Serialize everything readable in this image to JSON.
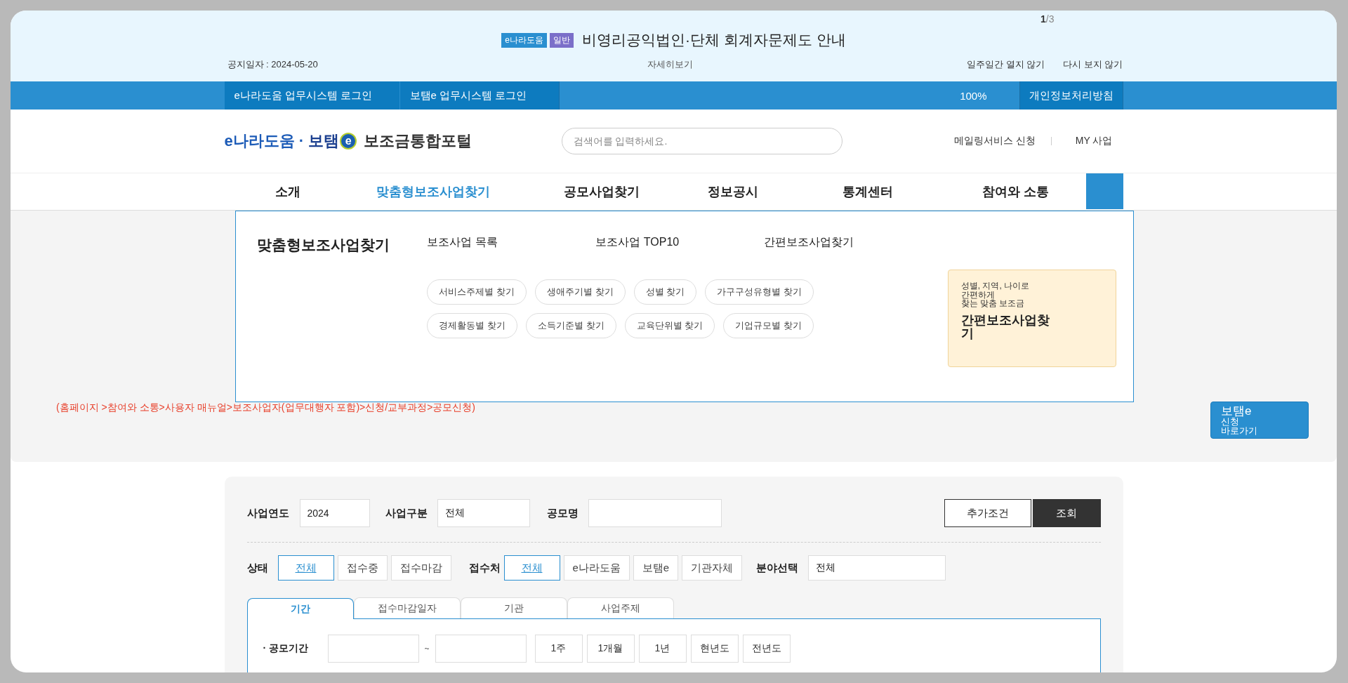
{
  "notice": {
    "counter": {
      "current": "1",
      "total": "/3"
    },
    "badges": [
      {
        "label": "e나라도움",
        "color": "#2a8fd0"
      },
      {
        "label": "일반",
        "color": "#7b6fc9"
      }
    ],
    "title": "비영리공익법인·단체 회계자문제도 안내",
    "date": "공지일자 : 2024-05-20",
    "detail": "자세히보기",
    "actions": [
      "일주일간 열지 않기",
      "다시 보지 않기"
    ]
  },
  "topbar": {
    "logins": [
      "e나라도움 업무시스템 로그인",
      "보탬e 업무시스템 로그인"
    ],
    "zoom": "100%",
    "privacy": "개인정보처리방침"
  },
  "header": {
    "logo": {
      "brand_1": "e나라도움",
      "dot": "·",
      "brand_2": "보탬",
      "mark": "e",
      "portal": "보조금통합포털"
    },
    "search": {
      "placeholder": "검색어를 입력하세요."
    },
    "links": [
      "메일링서비스 신청",
      "MY 사업"
    ]
  },
  "nav": {
    "items": [
      {
        "label": "소개",
        "selected": false
      },
      {
        "label": "맞춤형보조사업찾기",
        "selected": true
      },
      {
        "label": "공모사업찾기",
        "selected": false
      },
      {
        "label": "정보공시",
        "selected": false
      },
      {
        "label": "통계센터",
        "selected": false
      },
      {
        "label": "참여와 소통",
        "selected": false
      }
    ]
  },
  "megamenu": {
    "title": "맞춤형보조사업찾기",
    "links": [
      "보조사업 목록",
      "보조사업 TOP10",
      "간편보조사업찾기"
    ],
    "chips": [
      [
        "서비스주제별 찾기",
        "생애주기별 찾기",
        "성별 찾기",
        "가구구성유형별 찾기"
      ],
      [
        "경제활동별 찾기",
        "소득기준별 찾기",
        "교육단위별 찾기",
        "기업규모별 찾기"
      ]
    ],
    "promo": {
      "lines": [
        "성별, 지역, 나이로",
        "간편하게",
        "찾는 맞춤 보조금"
      ],
      "title": "간편보조사업찾기"
    }
  },
  "guide": {
    "breadcrumb": "(홈페이지 >참여와 소통>사용자 매뉴얼>보조사업자(업무대행자 포함)>신청/교부과정>공모신청)",
    "button": [
      "보탬e",
      "신청",
      "바로가기"
    ]
  },
  "search_form": {
    "fields": [
      {
        "label": "사업연도",
        "value": "2024"
      },
      {
        "label": "사업구분",
        "value": "전체"
      },
      {
        "label": "공모명"
      }
    ],
    "buttons": [
      {
        "label": "추가조건",
        "kind": "outline"
      },
      {
        "label": "조회",
        "kind": "dark"
      }
    ],
    "status": {
      "label": "상태",
      "options": [
        {
          "label": "전체",
          "selected": true
        },
        {
          "label": "접수중",
          "selected": false
        },
        {
          "label": "접수마감",
          "selected": false
        }
      ]
    },
    "receiver": {
      "label": "접수처",
      "options": [
        {
          "label": "전체",
          "selected": true
        },
        {
          "label": "e나라도움",
          "selected": false
        },
        {
          "label": "보탬e",
          "selected": false
        },
        {
          "label": "기관자체",
          "selected": false
        }
      ]
    },
    "field_select": {
      "label": "분야선택",
      "value": "전체"
    },
    "tabs": [
      {
        "label": "기간",
        "selected": true
      },
      {
        "label": "접수마감일자",
        "selected": false
      },
      {
        "label": "기관",
        "selected": false
      },
      {
        "label": "사업주제",
        "selected": false
      }
    ],
    "period_rows": [
      {
        "label": "· 공모기간",
        "separator": "~",
        "presets": [
          "1주",
          "1개월",
          "1년",
          "현년도",
          "전년도"
        ]
      }
    ]
  }
}
